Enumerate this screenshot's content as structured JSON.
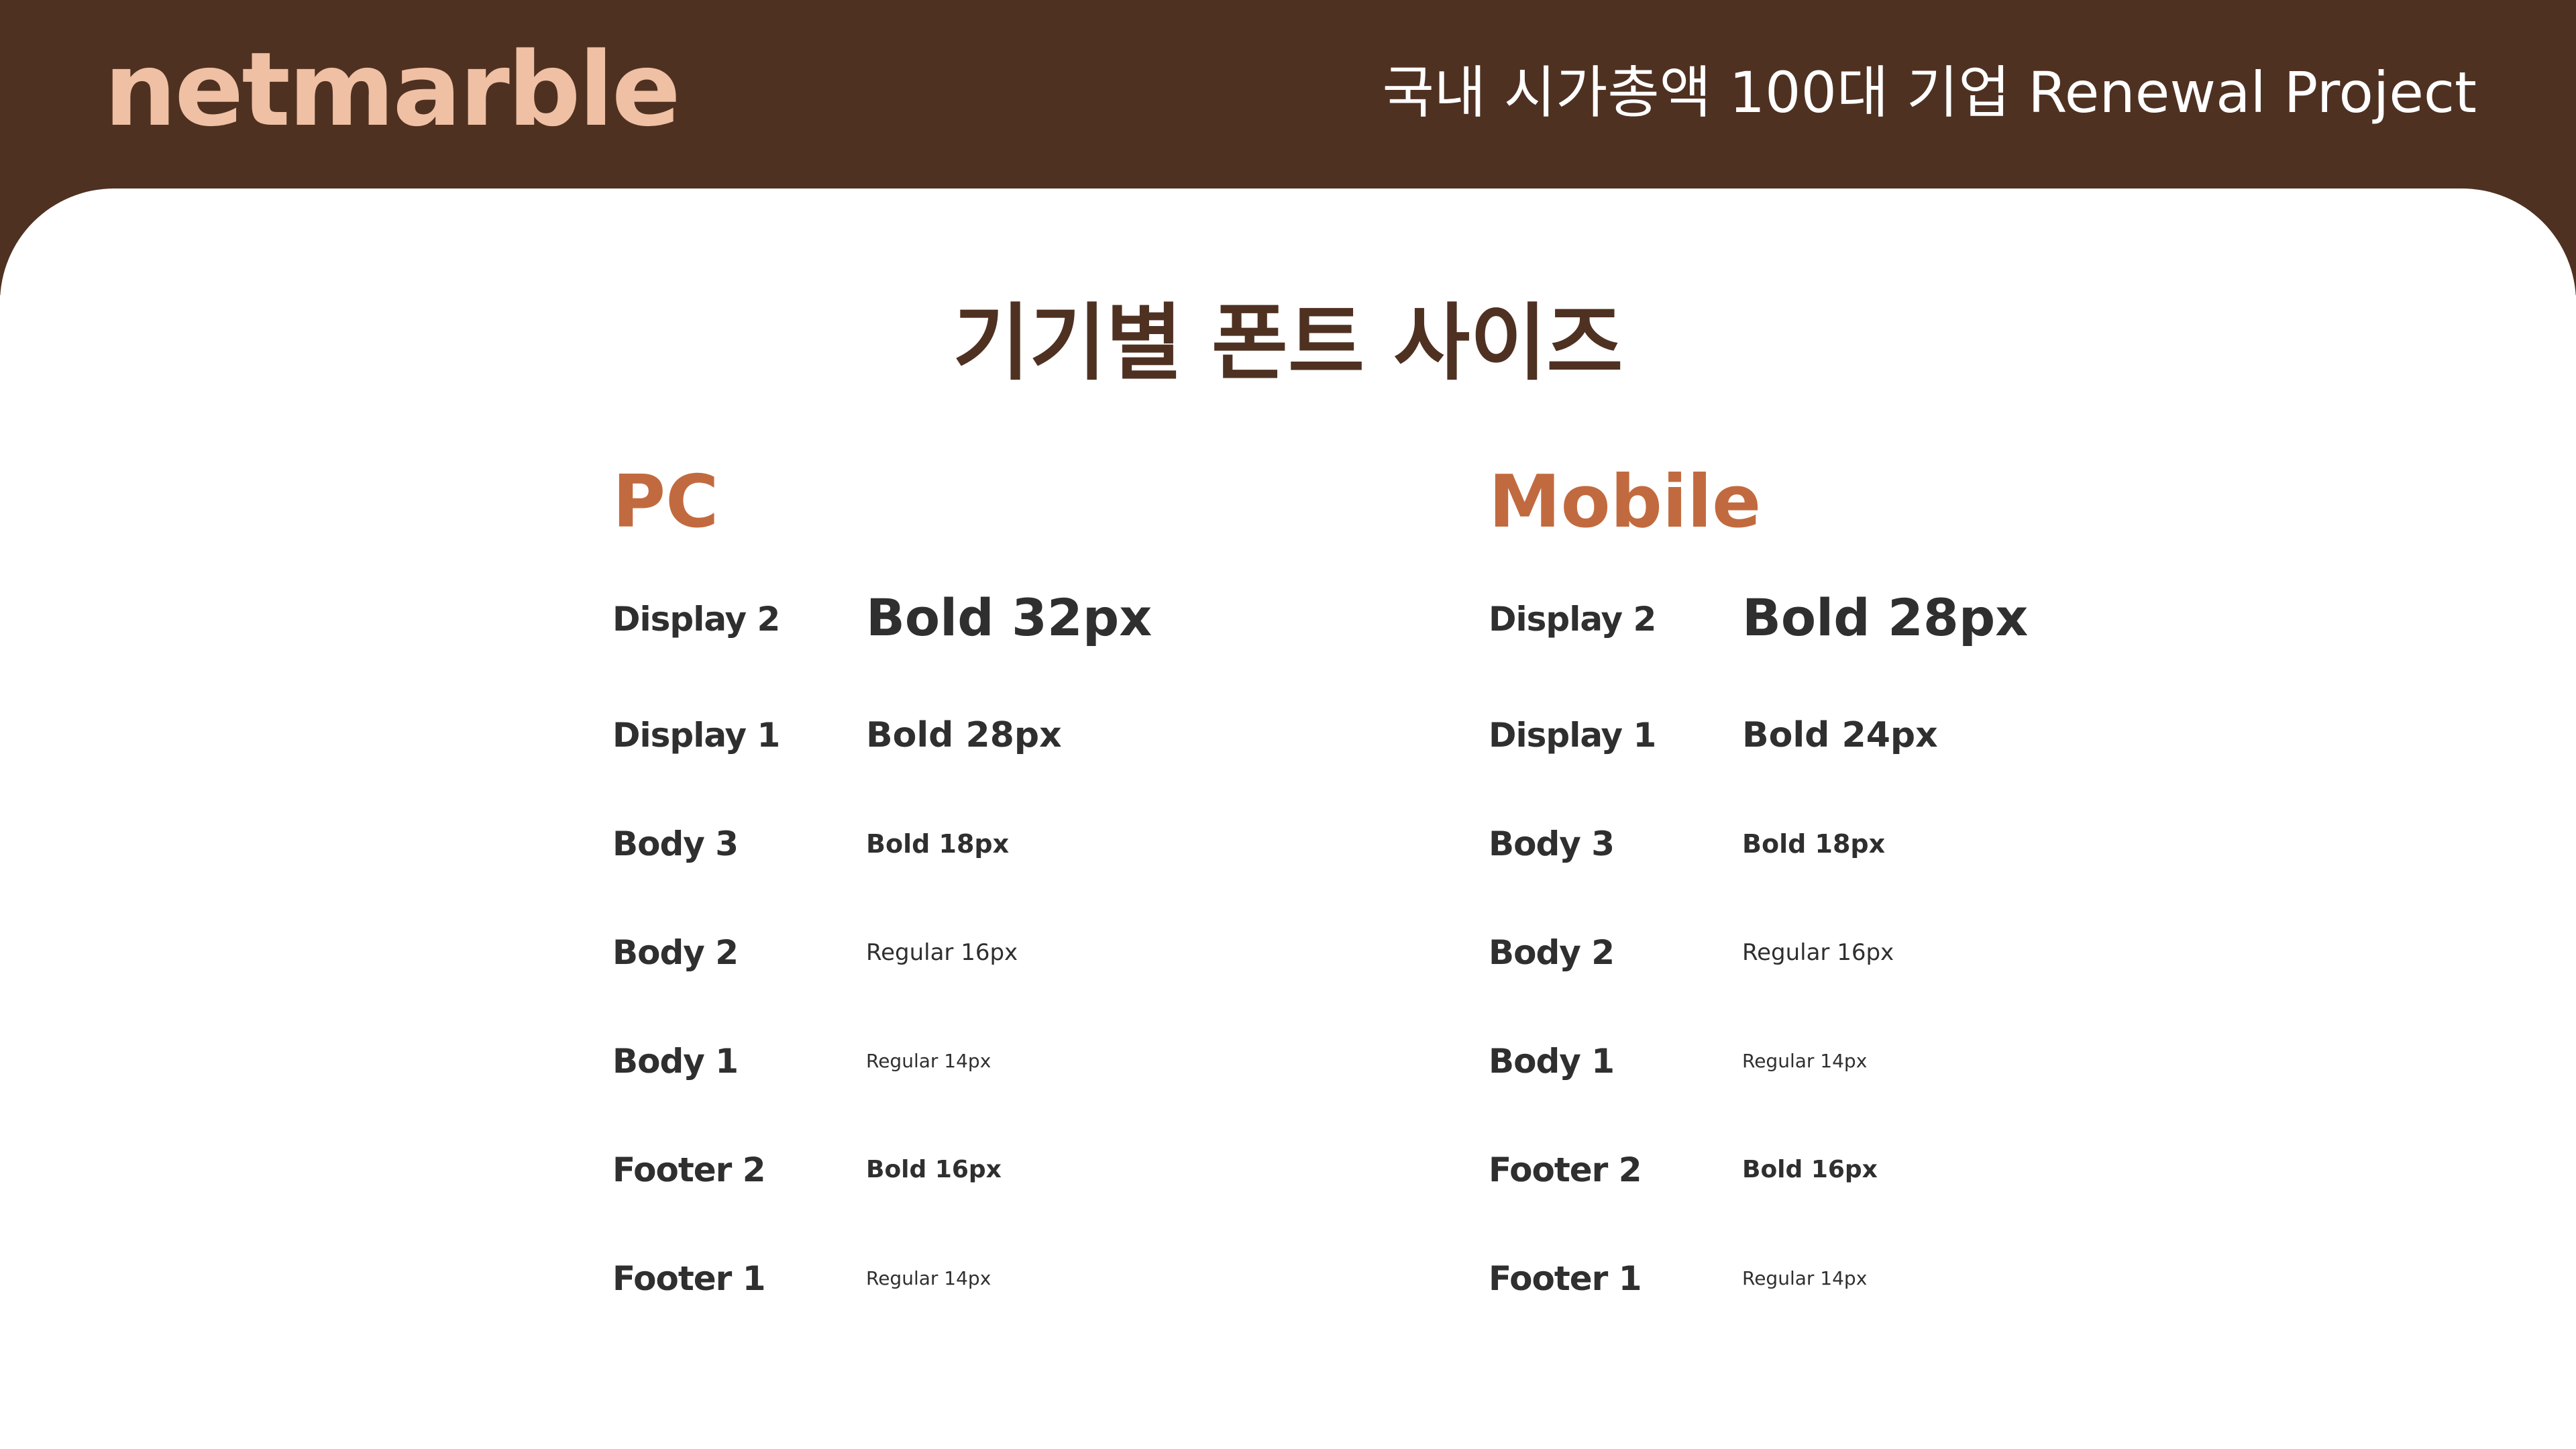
{
  "header": {
    "logo": "netmarble",
    "project_title": "국내 시가총액 100대 기업 Renewal Project"
  },
  "page_title": "기기별 폰트 사이즈",
  "pc": {
    "heading": "PC",
    "rows": [
      {
        "label": "Display 2",
        "value": "Bold 32px"
      },
      {
        "label": "Display 1",
        "value": "Bold 28px"
      },
      {
        "label": "Body 3",
        "value": "Bold 18px"
      },
      {
        "label": "Body 2",
        "value": "Regular 16px"
      },
      {
        "label": "Body 1",
        "value": "Regular 14px"
      },
      {
        "label": "Footer 2",
        "value": "Bold 16px"
      },
      {
        "label": "Footer 1",
        "value": "Regular 14px"
      }
    ]
  },
  "mobile": {
    "heading": "Mobile",
    "rows": [
      {
        "label": "Display 2",
        "value": "Bold 28px"
      },
      {
        "label": "Display 1",
        "value": "Bold 24px"
      },
      {
        "label": "Body 3",
        "value": "Bold 18px"
      },
      {
        "label": "Body 2",
        "value": "Regular 16px"
      },
      {
        "label": "Body 1",
        "value": "Regular 14px"
      },
      {
        "label": "Footer 2",
        "value": "Bold 16px"
      },
      {
        "label": "Footer 1",
        "value": "Regular 14px"
      }
    ]
  },
  "colors": {
    "header_bg": "#4f3122",
    "logo": "#efc0a3",
    "accent": "#c26a3f",
    "text": "#2f2f2f"
  }
}
